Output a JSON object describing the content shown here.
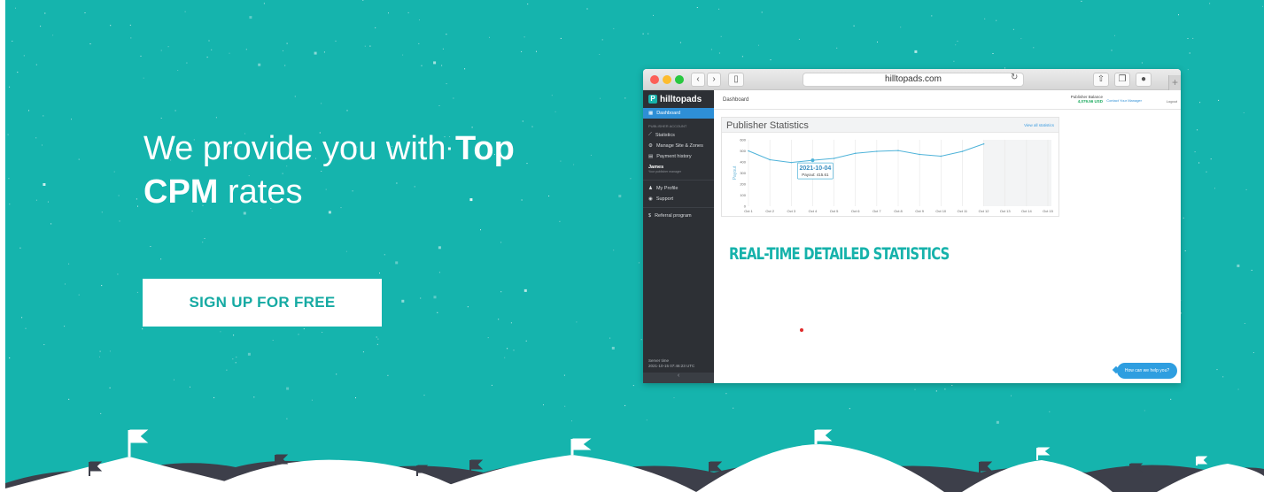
{
  "hero": {
    "headline_pre": "We provide you with ",
    "headline_bold1": "Top",
    "headline_bold2": "CPM",
    "headline_post": " rates",
    "cta_label": "SIGN UP FOR FREE",
    "colors": {
      "background": "#15b4ad",
      "accent": "#16aaa3",
      "white": "#ffffff"
    }
  },
  "browser": {
    "url": "hilltopads.com",
    "nav_back_icon": "chevron-left-icon",
    "nav_forward_icon": "chevron-right-icon",
    "sidebar_toggle_icon": "sidebar-icon",
    "share_icon": "share-icon",
    "tabs_icon": "tabs-icon",
    "download_icon": "download-icon",
    "new_tab_label": "+"
  },
  "dashboard": {
    "logo": "hilltopads",
    "page_title": "Dashboard",
    "balance_label": "Publisher Balance",
    "balance_value": "4,079.56 USD",
    "contact_label": "Contact Your Manager",
    "logout_label": "Logout",
    "sidebar": {
      "dashboard": "Dashboard",
      "section": "PUBLISHER ACCOUNT",
      "statistics": "Statistics",
      "manage": "Manage Site & Zones",
      "payment": "Payment history",
      "user_name": "James",
      "user_role": "Your publisher manager",
      "profile": "My Profile",
      "support": "Support",
      "referral": "Referral program",
      "server_label": "Server time",
      "server_time": "2021-10-15 07:46:23 UTC",
      "collapse": "‹"
    },
    "stats_title": "Publisher Statistics",
    "stats_link": "View all statistics",
    "realtime_title": "REAL-TIME DETAILED STATISTICS",
    "chat_label": "How can we help you?"
  },
  "chart_data": {
    "type": "line",
    "ylabel": "Payout",
    "ylim": [
      0,
      600
    ],
    "y_ticks": [
      0,
      100,
      200,
      300,
      400,
      500,
      600
    ],
    "categories": [
      "Oct 1",
      "Oct 2",
      "Oct 3",
      "Oct 4",
      "Oct 5",
      "Oct 6",
      "Oct 7",
      "Oct 8",
      "Oct 9",
      "Oct 10",
      "Oct 11",
      "Oct 12",
      "Oct 13",
      "Oct 14",
      "Oct 15"
    ],
    "values": [
      500,
      420,
      395,
      415,
      432,
      478,
      496,
      503,
      468,
      452,
      495,
      563,
      null,
      null,
      null
    ],
    "grid": true,
    "tooltip": {
      "category_index": 3,
      "title": "2021-10-04",
      "text": "Payout: 415.61"
    },
    "line_color": "#4fb3d9"
  }
}
